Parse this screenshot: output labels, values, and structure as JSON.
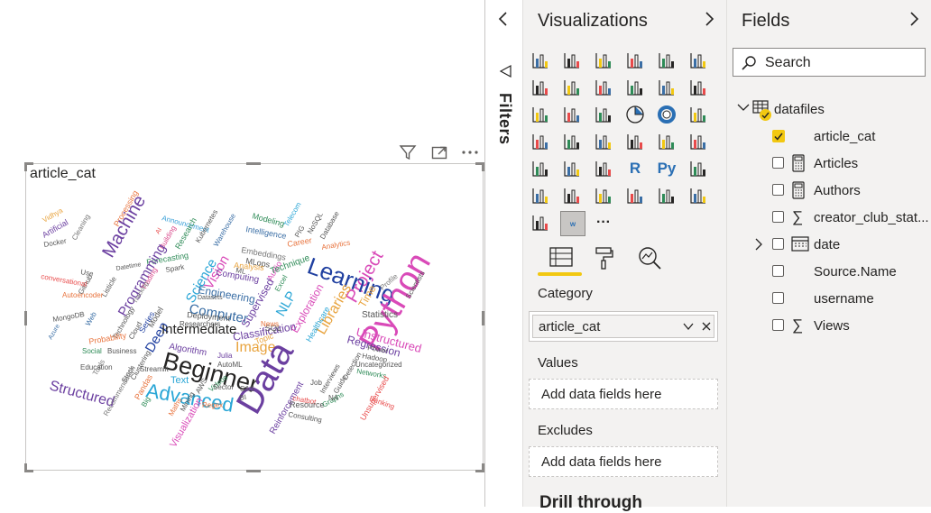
{
  "canvas": {
    "visual_title": "article_cat",
    "words": [
      {
        "t": "Vidhya",
        "c": "#e8a33d"
      },
      {
        "t": "Artificial",
        "c": "#6b3fa0"
      },
      {
        "t": "Docker",
        "c": "#555"
      },
      {
        "t": "Cleaning",
        "c": "#777"
      },
      {
        "t": "Processing",
        "c": "#e8733d"
      },
      {
        "t": "Machine",
        "c": "#6b3fa0"
      },
      {
        "t": "Announcement",
        "c": "#3aa0d8"
      },
      {
        "t": "Building",
        "c": "#d94a8c"
      },
      {
        "t": "AI",
        "c": "#e84a4a"
      },
      {
        "t": "Research",
        "c": "#2e8b57"
      },
      {
        "t": "Kubernetes",
        "c": "#555"
      },
      {
        "t": "Warehouse",
        "c": "#3a6ea5"
      },
      {
        "t": "Modeling",
        "c": "#2e8b57"
      },
      {
        "t": "Intelligence",
        "c": "#3a6ea5"
      },
      {
        "t": "Telecom",
        "c": "#2aa6d6"
      },
      {
        "t": "PIG",
        "c": "#555"
      },
      {
        "t": "NoSQL",
        "c": "#555"
      },
      {
        "t": "Database",
        "c": "#555"
      },
      {
        "t": "Career",
        "c": "#e8733d"
      },
      {
        "t": "Analytics",
        "c": "#e8733d"
      },
      {
        "t": "Project",
        "c": "#d94ab8"
      },
      {
        "t": "Learning",
        "c": "#2040a0"
      },
      {
        "t": "Forecasting",
        "c": "#2e8b57"
      },
      {
        "t": "Spark",
        "c": "#555"
      },
      {
        "t": "Vision",
        "c": "#d94ab8"
      },
      {
        "t": "Science",
        "c": "#2aa6d6"
      },
      {
        "t": "Embeddings",
        "c": "#777"
      },
      {
        "t": "MLops",
        "c": "#555"
      },
      {
        "t": "ML",
        "c": "#555"
      },
      {
        "t": "Analysis",
        "c": "#e8a33d"
      },
      {
        "t": "Audio",
        "c": "#d94ab8"
      },
      {
        "t": "Technique",
        "c": "#2e8b57"
      },
      {
        "t": "Programming",
        "c": "#6b3fa0"
      },
      {
        "t": "Datetime",
        "c": "#555"
      },
      {
        "t": "Trading",
        "c": "#d94a8c"
      },
      {
        "t": "Tracking",
        "c": "#777"
      },
      {
        "t": "Use",
        "c": "#555"
      },
      {
        "t": "Github",
        "c": "#555"
      },
      {
        "t": "Listicle",
        "c": "#555"
      },
      {
        "t": "conversational",
        "c": "#e84a4a"
      },
      {
        "t": "Autoencoder",
        "c": "#e8733d"
      },
      {
        "t": "Engineering",
        "c": "#3a6ea5"
      },
      {
        "t": "Computing",
        "c": "#6b3fa0"
      },
      {
        "t": "Datasets",
        "c": "#555"
      },
      {
        "t": "Computer",
        "c": "#3a6ea5"
      },
      {
        "t": "Deployment",
        "c": "#555"
      },
      {
        "t": "Supervised",
        "c": "#6b3fa0"
      },
      {
        "t": "Excel",
        "c": "#2e8b57"
      },
      {
        "t": "NLP",
        "c": "#2aa6d6"
      },
      {
        "t": "Exploration",
        "c": "#d94ab8"
      },
      {
        "t": "Libraries",
        "c": "#e8a33d"
      },
      {
        "t": "Python",
        "c": "#d94ab8"
      },
      {
        "t": "Time",
        "c": "#e8a33d"
      },
      {
        "t": "Profile",
        "c": "#777"
      },
      {
        "t": "Scientists",
        "c": "#555"
      },
      {
        "t": "Statistics",
        "c": "#555"
      },
      {
        "t": "Unstructured",
        "c": "#d94ab8"
      },
      {
        "t": "Regression",
        "c": "#6b3fa0"
      },
      {
        "t": "Power",
        "c": "#555"
      },
      {
        "t": "Hadoop",
        "c": "#555"
      },
      {
        "t": "Uncategorized",
        "c": "#555"
      },
      {
        "t": "Networks",
        "c": "#2e8b57"
      },
      {
        "t": "Banking",
        "c": "#e84a4a"
      },
      {
        "t": "Azure",
        "c": "#3a6ea5"
      },
      {
        "t": "Web",
        "c": "#3a6ea5"
      },
      {
        "t": "MongoDB",
        "c": "#555"
      },
      {
        "t": "Technology",
        "c": "#555"
      },
      {
        "t": "Probability",
        "c": "#e8733d"
      },
      {
        "t": "Social",
        "c": "#2e8b57"
      },
      {
        "t": "Business",
        "c": "#555"
      },
      {
        "t": "Cloud",
        "c": "#555"
      },
      {
        "t": "Series",
        "c": "#2040a0"
      },
      {
        "t": "Deep",
        "c": "#2040a0"
      },
      {
        "t": "Algorithm",
        "c": "#6b3fa0"
      },
      {
        "t": "Intermediate",
        "c": "#252423"
      },
      {
        "t": "Model",
        "c": "#555"
      },
      {
        "t": "Researchers",
        "c": "#555"
      },
      {
        "t": "Classification",
        "c": "#6b3fa0"
      },
      {
        "t": "Image",
        "c": "#e8a33d"
      },
      {
        "t": "Topic",
        "c": "#e8a33d"
      },
      {
        "t": "Julia",
        "c": "#6b3fa0"
      },
      {
        "t": "AutoML",
        "c": "#555"
      },
      {
        "t": "Education",
        "c": "#555"
      },
      {
        "t": "Structured",
        "c": "#6b3fa0"
      },
      {
        "t": "Stock",
        "c": "#555"
      },
      {
        "t": "Clustering",
        "c": "#555"
      },
      {
        "t": "Recommendation",
        "c": "#777"
      },
      {
        "t": "Pandas",
        "c": "#e8733d"
      },
      {
        "t": "Big",
        "c": "#2e8b57"
      },
      {
        "t": "Beginner",
        "c": "#252423"
      },
      {
        "t": "Advanced",
        "c": "#2aa6d6"
      },
      {
        "t": "Text",
        "c": "#2aa6d6"
      },
      {
        "t": "Maths",
        "c": "#e8733d"
      },
      {
        "t": "Mining",
        "c": "#555"
      },
      {
        "t": "Visualization",
        "c": "#d94ab8"
      },
      {
        "t": "Regex",
        "c": "#e8733d"
      },
      {
        "t": "AWS",
        "c": "#555"
      },
      {
        "t": "Videos",
        "c": "#2e8b57"
      },
      {
        "t": "Sector",
        "c": "#555"
      },
      {
        "t": "Data",
        "c": "#6b3fa0"
      },
      {
        "t": "SAS",
        "c": "#555"
      },
      {
        "t": "BI",
        "c": "#555"
      },
      {
        "t": "Reinforcement",
        "c": "#6b3fa0"
      },
      {
        "t": "chatbot",
        "c": "#e84a4a"
      },
      {
        "t": "Resource",
        "c": "#555"
      },
      {
        "t": "Consulting",
        "c": "#555"
      },
      {
        "t": "Graphs",
        "c": "#2e8b57"
      },
      {
        "t": "Unsupervised",
        "c": "#e84a4a"
      },
      {
        "t": "Interviews",
        "c": "#555"
      },
      {
        "t": "Detection",
        "c": "#555"
      },
      {
        "t": "Healthcare",
        "c": "#2aa6d6"
      },
      {
        "t": "SQL",
        "c": "#555"
      },
      {
        "t": "News",
        "c": "#e8733d"
      },
      {
        "t": "Job",
        "c": "#555"
      },
      {
        "t": "Guide",
        "c": "#555"
      },
      {
        "t": "NA",
        "c": "#555"
      },
      {
        "t": "Streamlit",
        "c": "#555"
      },
      {
        "t": "Tools",
        "c": "#777"
      }
    ]
  },
  "filters": {
    "label": "Filters"
  },
  "visualizations": {
    "title": "Visualizations",
    "r_label": "R",
    "py_label": "Py",
    "more": "···",
    "category_label": "Category",
    "category_value": "article_cat",
    "values_label": "Values",
    "values_placeholder": "Add data fields here",
    "excludes_label": "Excludes",
    "excludes_placeholder": "Add data fields here",
    "drill_label": "Drill through"
  },
  "fields": {
    "title": "Fields",
    "search_placeholder": "Search",
    "table_name": "datafiles",
    "items": [
      {
        "label": "article_cat",
        "checked": true
      },
      {
        "label": "Articles",
        "checked": false
      },
      {
        "label": "Authors",
        "checked": false
      },
      {
        "label": "creator_club_stat...",
        "checked": false
      },
      {
        "label": "date",
        "checked": false
      },
      {
        "label": "Source.Name",
        "checked": false
      },
      {
        "label": "username",
        "checked": false
      },
      {
        "label": "Views",
        "checked": false
      }
    ]
  },
  "colors": {
    "accent": "#f2c811",
    "pane_bg": "#f3f2f1",
    "border": "#c8c6c4"
  }
}
